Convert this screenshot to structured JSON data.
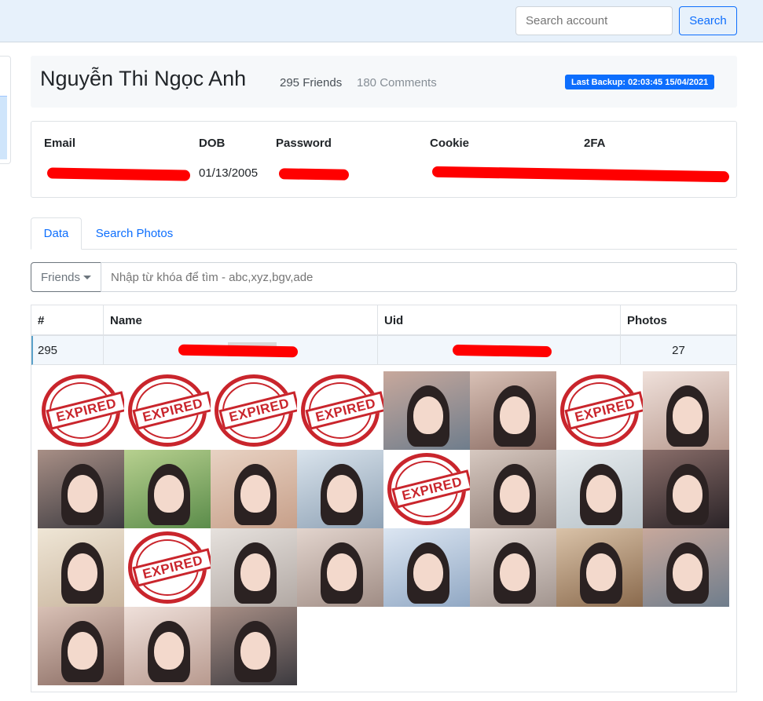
{
  "navbar": {
    "search_placeholder": "Search account",
    "search_button": "Search"
  },
  "profile": {
    "name": "Nguyễn Thi Ngọc Anh",
    "friends": "295 Friends",
    "comments": "180 Comments",
    "last_backup": "Last Backup: 02:03:45 15/04/2021"
  },
  "credentials": {
    "headers": [
      "Email",
      "DOB",
      "Password",
      "Cookie",
      "2FA"
    ],
    "dob": "01/13/2005"
  },
  "tabs": [
    {
      "label": "Data",
      "active": true
    },
    {
      "label": "Search Photos",
      "active": false
    }
  ],
  "filter": {
    "dropdown_label": "Friends",
    "placeholder": "Nhập từ khóa để tìm - abc,xyz,bgv,ade"
  },
  "table": {
    "columns": [
      "#",
      "Name",
      "Uid",
      "Photos"
    ],
    "rows": [
      {
        "index": "295",
        "name": "",
        "uid": "",
        "photos": "27"
      }
    ]
  },
  "photos": {
    "stamp_text": "EXPIRED",
    "tiles": [
      "expired",
      "expired",
      "expired",
      "expired",
      "photo",
      "photo",
      "expired",
      "photo",
      "photo",
      "photo",
      "photo",
      "photo",
      "expired",
      "photo",
      "photo",
      "photo",
      "photo",
      "expired",
      "photo",
      "photo",
      "photo",
      "photo",
      "photo",
      "photo",
      "photo",
      "photo",
      "photo"
    ]
  },
  "colors": {
    "accent": "#0d6efd",
    "redaction": "#ff0000",
    "stamp": "#c9252c"
  }
}
